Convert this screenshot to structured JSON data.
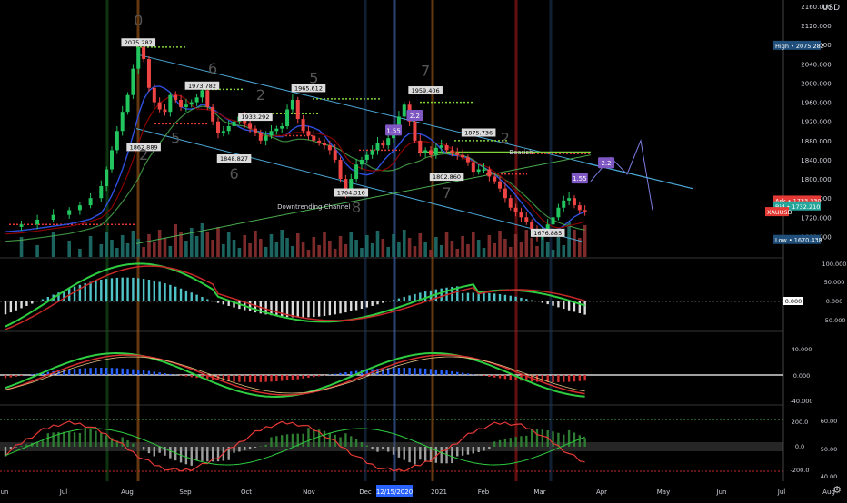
{
  "app": {
    "currency": "USD"
  },
  "colors": {
    "background": "#000000",
    "up": "#22c55e",
    "down": "#ef4444",
    "text": "#d1d4dc",
    "axis_line": "#d1d4dc",
    "channel": "#4ba7d6",
    "ma_blue": "#2f4fe0",
    "ma_green": "#4caf50",
    "ma_dark_red": "#8b0000",
    "dotted_green": "#7fd43a",
    "projection": "#7e7ee6",
    "label_bg": "#1f4f7a",
    "label_white_bg": "#dcdcdc",
    "purple": "#7e57c2",
    "ask_red": "#e53935",
    "bid_green": "#26a69a",
    "orange_vline": "#b5651d",
    "zero_line": "#ffffff"
  },
  "chart_data": [
    {
      "type": "candlestick",
      "symbol": "XAUUSD",
      "ylim": [
        1660,
        2160
      ],
      "price_ticks": [
        "2160.000",
        "2120.000",
        "2080.000",
        "2040.000",
        "2000.000",
        "1960.000",
        "1920.000",
        "1880.000",
        "1840.000",
        "1800.000",
        "1760.000",
        "1720.000",
        "1680.000"
      ],
      "x_ticks": [
        "Jun",
        "Jul",
        "Aug",
        "Sep",
        "Oct",
        "Nov",
        "Dec",
        "2021",
        "Feb",
        "Mar",
        "Apr",
        "May",
        "Jun",
        "Jul",
        "Aug"
      ],
      "highlighted_date": "12/15/2020",
      "high_label": "High",
      "high_value": "2075.282",
      "ask_label": "Ask",
      "ask_value": "1733.330",
      "bid_label": "Bid",
      "bid_value": "1732.210",
      "symbol_tag": "XAUUSD",
      "low_label": "Low",
      "low_value": "1670.438",
      "price_path": [
        [
          0,
          1700
        ],
        [
          3,
          1705
        ],
        [
          6,
          1715
        ],
        [
          9,
          1725
        ],
        [
          12,
          1735
        ],
        [
          14,
          1745
        ],
        [
          16,
          1760
        ],
        [
          18,
          1785
        ],
        [
          19,
          1820
        ],
        [
          20,
          1860
        ],
        [
          21,
          1900
        ],
        [
          22,
          1940
        ],
        [
          23,
          1975
        ],
        [
          24,
          2030
        ],
        [
          25,
          2075
        ],
        [
          26,
          2050
        ],
        [
          27,
          1990
        ],
        [
          28,
          1960
        ],
        [
          29,
          1945
        ],
        [
          30,
          1940
        ],
        [
          31,
          1975
        ],
        [
          32,
          1965
        ],
        [
          33,
          1950
        ],
        [
          34,
          1955
        ],
        [
          35,
          1960
        ],
        [
          36,
          1970
        ],
        [
          37,
          1985
        ],
        [
          38,
          1950
        ],
        [
          39,
          1920
        ],
        [
          40,
          1895
        ],
        [
          41,
          1900
        ],
        [
          42,
          1910
        ],
        [
          43,
          1920
        ],
        [
          44,
          1930
        ],
        [
          45,
          1915
        ],
        [
          46,
          1905
        ],
        [
          47,
          1895
        ],
        [
          48,
          1880
        ],
        [
          49,
          1890
        ],
        [
          50,
          1900
        ],
        [
          51,
          1905
        ],
        [
          52,
          1910
        ],
        [
          53,
          1945
        ],
        [
          54,
          1965
        ],
        [
          55,
          1925
        ],
        [
          56,
          1900
        ],
        [
          57,
          1890
        ],
        [
          58,
          1880
        ],
        [
          59,
          1875
        ],
        [
          60,
          1870
        ],
        [
          61,
          1860
        ],
        [
          62,
          1840
        ],
        [
          63,
          1800
        ],
        [
          64,
          1770
        ],
        [
          65,
          1800
        ],
        [
          66,
          1830
        ],
        [
          67,
          1840
        ],
        [
          68,
          1850
        ],
        [
          69,
          1860
        ],
        [
          70,
          1875
        ],
        [
          71,
          1870
        ],
        [
          72,
          1885
        ],
        [
          73,
          1900
        ],
        [
          74,
          1930
        ],
        [
          75,
          1955
        ],
        [
          76,
          1920
        ],
        [
          77,
          1880
        ],
        [
          78,
          1855
        ],
        [
          79,
          1860
        ],
        [
          80,
          1850
        ],
        [
          81,
          1865
        ],
        [
          82,
          1870
        ],
        [
          83,
          1860
        ],
        [
          84,
          1855
        ],
        [
          85,
          1850
        ],
        [
          86,
          1845
        ],
        [
          87,
          1835
        ],
        [
          88,
          1815
        ],
        [
          89,
          1820
        ],
        [
          90,
          1820
        ],
        [
          91,
          1805
        ],
        [
          92,
          1795
        ],
        [
          93,
          1780
        ],
        [
          94,
          1760
        ],
        [
          95,
          1740
        ],
        [
          96,
          1730
        ],
        [
          97,
          1720
        ],
        [
          98,
          1710
        ],
        [
          99,
          1695
        ],
        [
          100,
          1680
        ],
        [
          101,
          1690
        ],
        [
          102,
          1705
        ],
        [
          103,
          1720
        ],
        [
          104,
          1740
        ],
        [
          105,
          1755
        ],
        [
          106,
          1760
        ],
        [
          107,
          1745
        ],
        [
          108,
          1735
        ],
        [
          109,
          1733
        ]
      ],
      "annotations": [
        {
          "text": "2075.282",
          "x": 25,
          "y": 2080
        },
        {
          "text": "1862.889",
          "x": 26,
          "y": 1862
        },
        {
          "text": "1973.782",
          "x": 37,
          "y": 1990
        },
        {
          "text": "1933.292",
          "x": 47,
          "y": 1925
        },
        {
          "text": "1848.827",
          "x": 43,
          "y": 1838
        },
        {
          "text": "1965.612",
          "x": 57,
          "y": 1985
        },
        {
          "text": "1764.316",
          "x": 65,
          "y": 1767
        },
        {
          "text": "1959.406",
          "x": 79,
          "y": 1980
        },
        {
          "text": "1875.736",
          "x": 89,
          "y": 1892
        },
        {
          "text": "1802.860",
          "x": 83,
          "y": 1800
        },
        {
          "text": "1676.885",
          "x": 102,
          "y": 1683
        },
        {
          "text": "Downtrending Channel",
          "x": 58,
          "y": 1738
        },
        {
          "text": "Bearish",
          "x": 97,
          "y": 1851
        },
        {
          "text": "1.55",
          "x": 73,
          "y": 1898
        },
        {
          "text": "2.2",
          "x": 77,
          "y": 1929
        },
        {
          "text": "1.55",
          "x": 108,
          "y": 1798
        },
        {
          "text": "2.2",
          "x": 113,
          "y": 1830
        }
      ],
      "wave_labels": [
        {
          "text": "0",
          "x": 25,
          "y": 2120
        },
        {
          "text": "2",
          "x": 26,
          "y": 1840
        },
        {
          "text": "5",
          "x": 32,
          "y": 1875
        },
        {
          "text": "6",
          "x": 39,
          "y": 2020
        },
        {
          "text": "6",
          "x": 43,
          "y": 1800
        },
        {
          "text": "2",
          "x": 48,
          "y": 1965
        },
        {
          "text": "5",
          "x": 58,
          "y": 2000
        },
        {
          "text": "8",
          "x": 66,
          "y": 1730
        },
        {
          "text": "7",
          "x": 79,
          "y": 2015
        },
        {
          "text": "7",
          "x": 83,
          "y": 1760
        },
        {
          "text": "2",
          "x": 94,
          "y": 1875
        }
      ]
    },
    {
      "type": "line",
      "name": "macd",
      "ylim": [
        -80,
        130
      ],
      "ticks": [
        "100.000",
        "50.000",
        "0.000",
        "-50.000"
      ],
      "zero_label": "0.000"
    },
    {
      "type": "line",
      "name": "oscillator",
      "ylim": [
        -55,
        60
      ],
      "ticks": [
        "40.000",
        "0.000",
        "-40.000"
      ]
    },
    {
      "type": "line",
      "name": "cci",
      "ylim_left": [
        -230,
        230
      ],
      "left_ticks": [
        "200.0",
        "0.0",
        "-200.0"
      ],
      "right_ticks": [
        "60.00",
        "50.00",
        "40.00"
      ]
    }
  ]
}
